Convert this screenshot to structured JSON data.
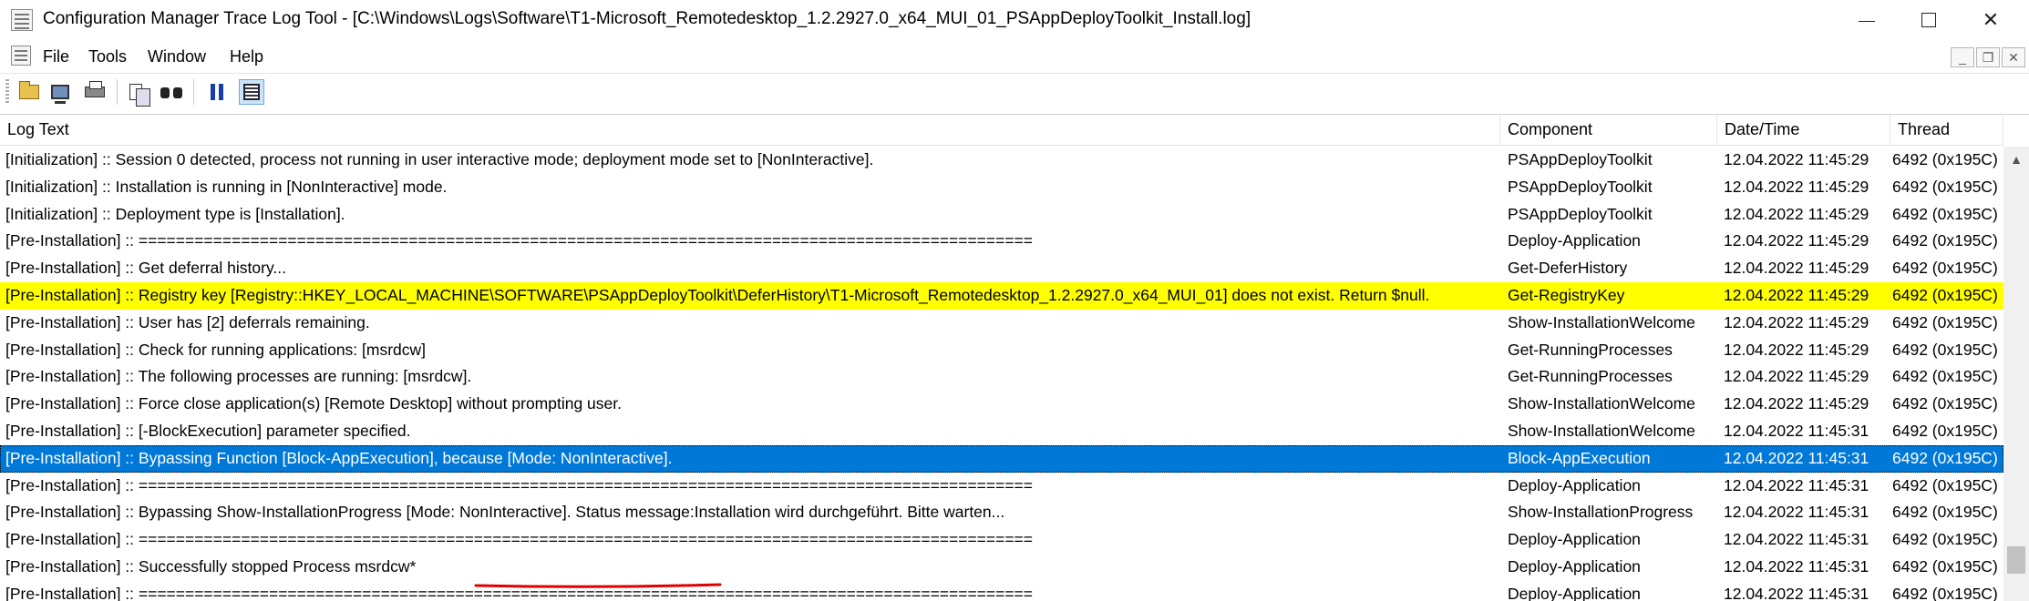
{
  "window": {
    "title": "Configuration Manager Trace Log Tool - [C:\\Windows\\Logs\\Software\\T1-Microsoft_Remotedesktop_1.2.2927.0_x64_MUI_01_PSAppDeployToolkit_Install.log]",
    "min_glyph": "—",
    "max_glyph": "☐",
    "close_glyph": "✕"
  },
  "menu": {
    "file": "File",
    "tools": "Tools",
    "window": "Window",
    "help": "Help",
    "mdi_min": "_",
    "mdi_restore": "❐",
    "mdi_close": "✕"
  },
  "toolbar": {
    "icons": [
      "open-icon",
      "computer-icon",
      "print-icon",
      "copy-icon",
      "find-icon",
      "pause-icon",
      "list-icon"
    ]
  },
  "columns": {
    "log_text": "Log Text",
    "component": "Component",
    "datetime": "Date/Time",
    "thread": "Thread"
  },
  "rows": [
    {
      "text": "[Initialization] :: Session 0 detected, process not running in user interactive mode; deployment mode set to [NonInteractive].",
      "component": "PSAppDeployToolkit",
      "datetime": "12.04.2022 11:45:29",
      "thread": "6492 (0x195C)",
      "state": "normal"
    },
    {
      "text": "[Initialization] :: Installation is running in [NonInteractive] mode.",
      "component": "PSAppDeployToolkit",
      "datetime": "12.04.2022 11:45:29",
      "thread": "6492 (0x195C)",
      "state": "normal"
    },
    {
      "text": "[Initialization] :: Deployment type is [Installation].",
      "component": "PSAppDeployToolkit",
      "datetime": "12.04.2022 11:45:29",
      "thread": "6492 (0x195C)",
      "state": "normal"
    },
    {
      "text": "[Pre-Installation] :: ================================================================================================",
      "component": "Deploy-Application",
      "datetime": "12.04.2022 11:45:29",
      "thread": "6492 (0x195C)",
      "state": "normal"
    },
    {
      "text": "[Pre-Installation] :: Get deferral history...",
      "component": "Get-DeferHistory",
      "datetime": "12.04.2022 11:45:29",
      "thread": "6492 (0x195C)",
      "state": "normal"
    },
    {
      "text": "[Pre-Installation] :: Registry key [Registry::HKEY_LOCAL_MACHINE\\SOFTWARE\\PSAppDeployToolkit\\DeferHistory\\T1-Microsoft_Remotedesktop_1.2.2927.0_x64_MUI_01] does not exist. Return $null.",
      "component": "Get-RegistryKey",
      "datetime": "12.04.2022 11:45:29",
      "thread": "6492 (0x195C)",
      "state": "warning"
    },
    {
      "text": "[Pre-Installation] :: User has [2] deferrals remaining.",
      "component": "Show-InstallationWelcome",
      "datetime": "12.04.2022 11:45:29",
      "thread": "6492 (0x195C)",
      "state": "normal"
    },
    {
      "text": "[Pre-Installation] :: Check for running applications: [msrdcw]",
      "component": "Get-RunningProcesses",
      "datetime": "12.04.2022 11:45:29",
      "thread": "6492 (0x195C)",
      "state": "normal"
    },
    {
      "text": "[Pre-Installation] :: The following processes are running: [msrdcw].",
      "component": "Get-RunningProcesses",
      "datetime": "12.04.2022 11:45:29",
      "thread": "6492 (0x195C)",
      "state": "normal"
    },
    {
      "text": "[Pre-Installation] :: Force close application(s) [Remote Desktop] without prompting user.",
      "component": "Show-InstallationWelcome",
      "datetime": "12.04.2022 11:45:29",
      "thread": "6492 (0x195C)",
      "state": "normal"
    },
    {
      "text": "[Pre-Installation] :: [-BlockExecution] parameter specified.",
      "component": "Show-InstallationWelcome",
      "datetime": "12.04.2022 11:45:31",
      "thread": "6492 (0x195C)",
      "state": "normal"
    },
    {
      "text": "[Pre-Installation] :: Bypassing Function [Block-AppExecution], because [Mode: NonInteractive].",
      "component": "Block-AppExecution",
      "datetime": "12.04.2022 11:45:31",
      "thread": "6492 (0x195C)",
      "state": "selected"
    },
    {
      "text": "[Pre-Installation] :: ================================================================================================",
      "component": "Deploy-Application",
      "datetime": "12.04.2022 11:45:31",
      "thread": "6492 (0x195C)",
      "state": "normal"
    },
    {
      "text": "[Pre-Installation] :: Bypassing Show-InstallationProgress [Mode: NonInteractive]. Status message:Installation wird durchgeführt. Bitte warten...",
      "component": "Show-InstallationProgress",
      "datetime": "12.04.2022 11:45:31",
      "thread": "6492 (0x195C)",
      "state": "normal"
    },
    {
      "text": "[Pre-Installation] :: ================================================================================================",
      "component": "Deploy-Application",
      "datetime": "12.04.2022 11:45:31",
      "thread": "6492 (0x195C)",
      "state": "normal"
    },
    {
      "text": "[Pre-Installation] :: Successfully stopped Process msrdcw*",
      "component": "Deploy-Application",
      "datetime": "12.04.2022 11:45:31",
      "thread": "6492 (0x195C)",
      "state": "normal"
    },
    {
      "text": "[Pre-Installation] :: ================================================================================================",
      "component": "Deploy-Application",
      "datetime": "12.04.2022 11:45:31",
      "thread": "6492 (0x195C)",
      "state": "normal"
    }
  ],
  "colors": {
    "warning_bg": "#ffff00",
    "selected_bg": "#0078d7",
    "annotation": "#e00000"
  },
  "scrollbar": {
    "up_glyph": "▲"
  }
}
